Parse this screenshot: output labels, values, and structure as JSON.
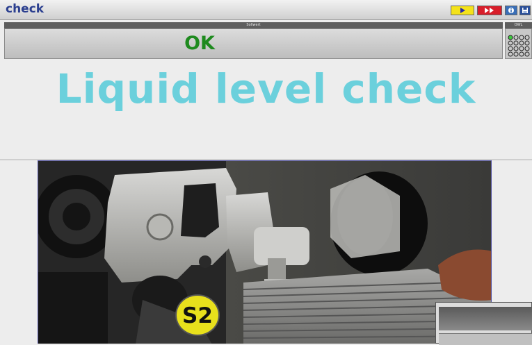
{
  "app": {
    "title": "check"
  },
  "toolbar": {
    "buttons": [
      {
        "name": "play-icon",
        "color": "#f4e21a"
      },
      {
        "name": "fast-forward-icon",
        "color": "#d81e2a"
      },
      {
        "name": "info-icon",
        "color": "#3a6fb8"
      },
      {
        "name": "save-icon",
        "color": "#2a4f9a"
      }
    ]
  },
  "status": {
    "header_label": "Sollwert",
    "value": "OK",
    "value_color": "#1e8a1e"
  },
  "controls": {
    "header_label": "OWL"
  },
  "instruction": {
    "title": "Liquid level check",
    "title_color": "#6bd0dc"
  },
  "photo": {
    "badge_label": "S2"
  }
}
